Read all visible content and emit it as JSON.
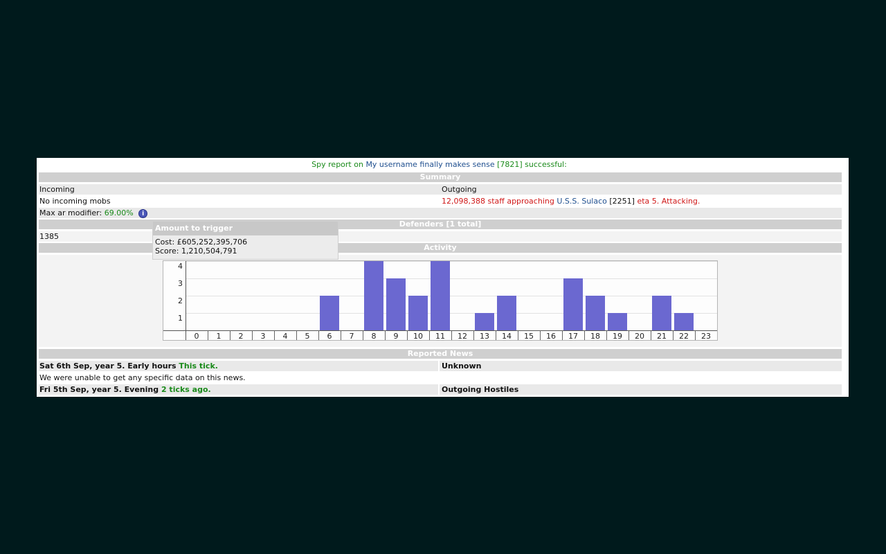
{
  "report": {
    "prefix": "Spy report on ",
    "target_name": "My username finally makes sense",
    "target_id": "[7821]",
    "suffix": "successful:"
  },
  "summary": {
    "header": "Summary",
    "incoming_label": "Incoming",
    "outgoing_label": "Outgoing",
    "incoming_value": "No incoming mobs",
    "outgoing_amount": "12,098,388 staff approaching",
    "outgoing_target": "U.S.S. Sulaco",
    "outgoing_target_id": "[2251]",
    "outgoing_status": "eta 5. Attacking.",
    "max_ar_label": "Max ar modifier:",
    "max_ar_value": "69.00%",
    "info_icon_glyph": "i"
  },
  "tooltip": {
    "title": "Amount to trigger",
    "cost": "Cost: £605,252,395,706",
    "score": "Score: 1,210,504,791"
  },
  "defenders": {
    "header": "Defenders [1 total]",
    "value": "1385"
  },
  "activity": {
    "header": "Activity"
  },
  "chart_data": {
    "type": "bar",
    "categories": [
      "0",
      "1",
      "2",
      "3",
      "4",
      "5",
      "6",
      "7",
      "8",
      "9",
      "10",
      "11",
      "12",
      "13",
      "14",
      "15",
      "16",
      "17",
      "18",
      "19",
      "20",
      "21",
      "22",
      "23"
    ],
    "values": [
      0,
      0,
      0,
      0,
      0,
      0,
      2,
      0,
      4,
      3,
      2,
      4,
      0,
      1,
      2,
      0,
      0,
      3,
      2,
      1,
      0,
      2,
      1,
      0
    ],
    "y_ticks": [
      "1",
      "2",
      "3",
      "4"
    ],
    "ylim": [
      0,
      4
    ],
    "grid": true,
    "bar_color": "#6b68d0"
  },
  "news": {
    "header": "Reported News",
    "items": [
      {
        "date": "Sat 6th Sep, year 5. Early hours",
        "when": "This tick.",
        "type": "Unknown",
        "body": "We were unable to get any specific data on this news."
      },
      {
        "date": "Fri 5th Sep, year 5. Evening",
        "when": "2 ticks ago.",
        "type": "Outgoing Hostiles"
      }
    ]
  }
}
